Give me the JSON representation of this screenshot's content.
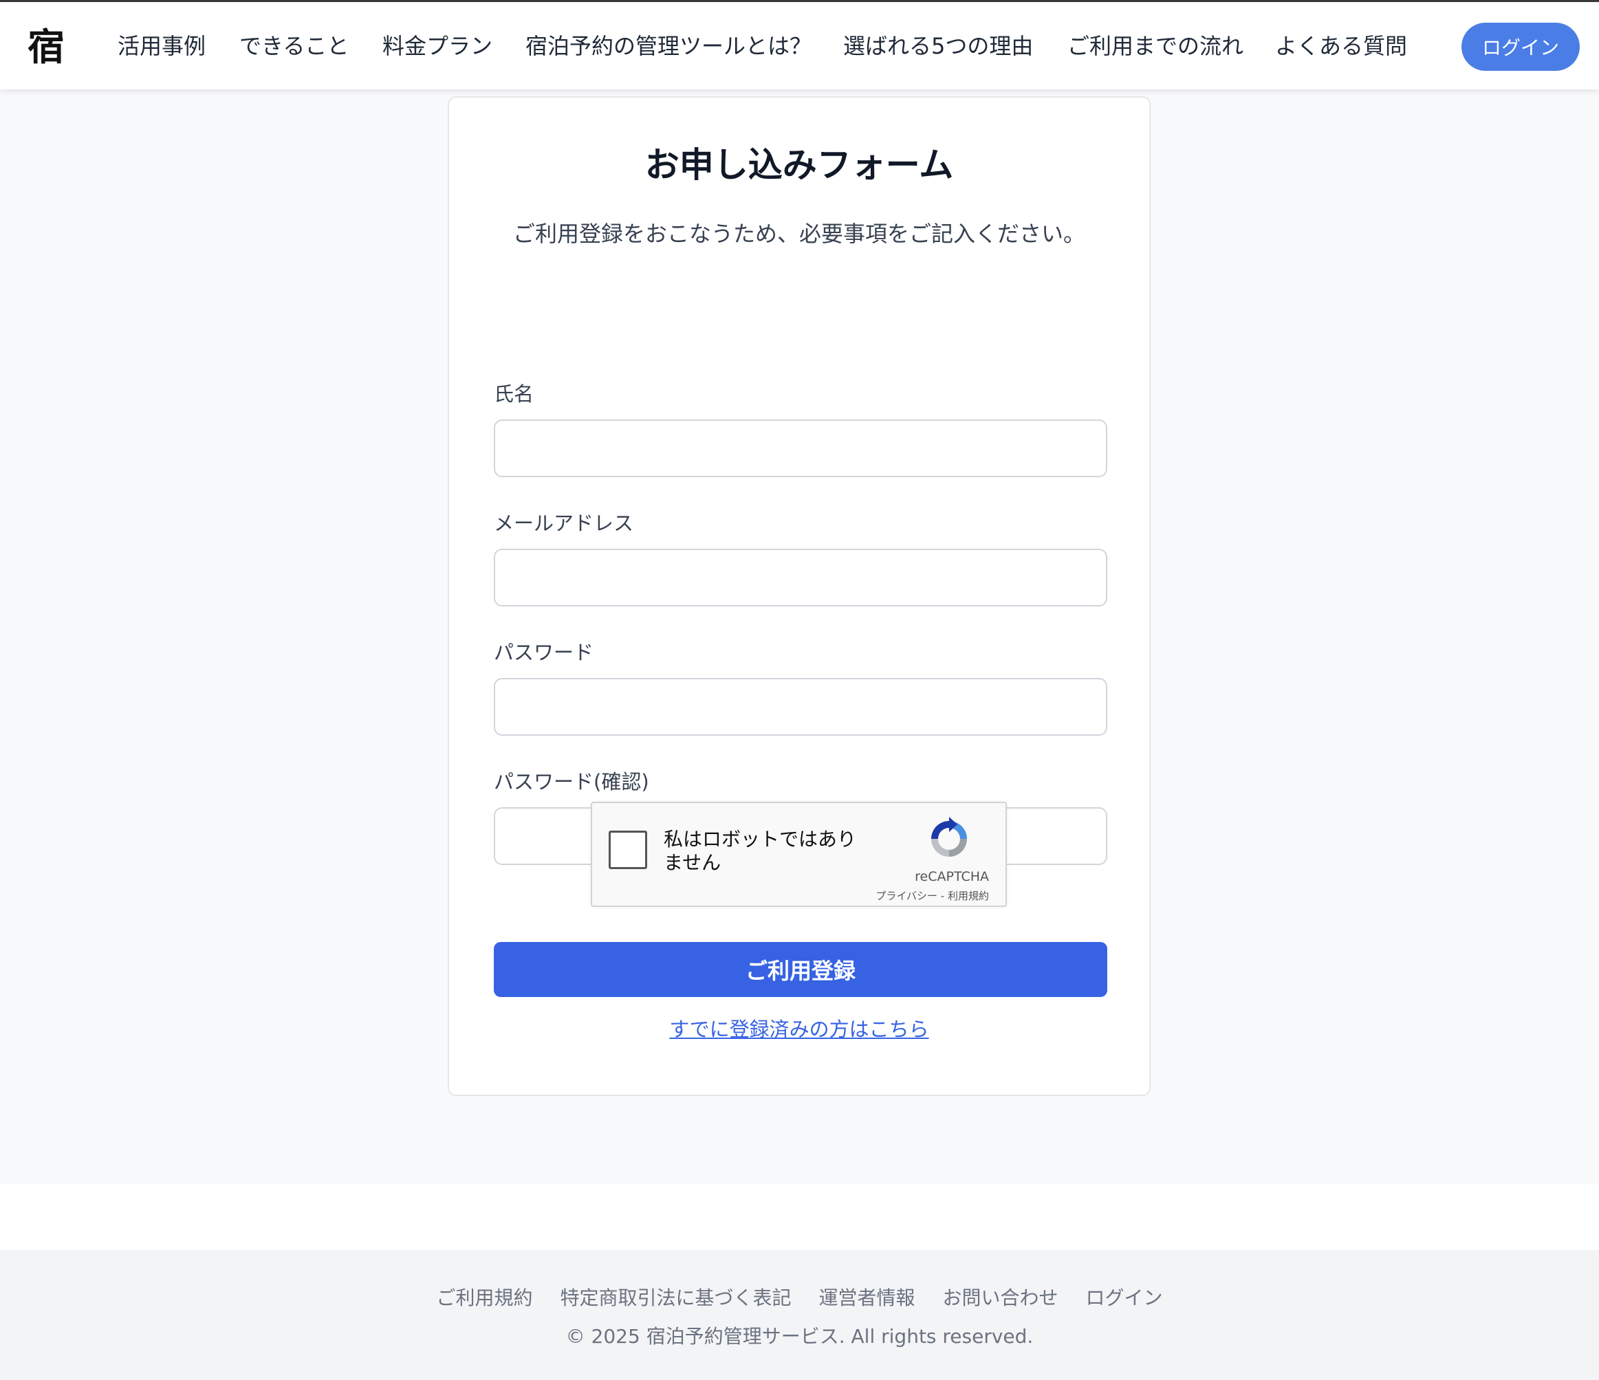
{
  "header": {
    "logo_glyph": "宿",
    "nav": [
      {
        "label": "活用事例"
      },
      {
        "label": "できること"
      },
      {
        "label": "料金プラン"
      },
      {
        "label": "宿泊予約の管理ツールとは？"
      },
      {
        "label": "選ばれる5つの理由"
      },
      {
        "label": "ご利用までの流れ"
      },
      {
        "label": "よくある質問"
      }
    ],
    "login_label": "ログイン",
    "accent_color": "#4a7ee6"
  },
  "form": {
    "title": "お申し込みフォーム",
    "subtitle": "ご利用登録をおこなうため、必要事項をご記入ください。",
    "fields": [
      {
        "label": "氏名",
        "value": "",
        "placeholder": ""
      },
      {
        "label": "メールアドレス",
        "value": "",
        "placeholder": ""
      },
      {
        "label": "パスワード",
        "value": "",
        "placeholder": ""
      },
      {
        "label": "パスワード(確認)",
        "value": "",
        "placeholder": ""
      }
    ],
    "captcha": {
      "label": "私はロボットではありません",
      "brand": "reCAPTCHA",
      "links": "プライバシー - 利用規約",
      "checked": false
    },
    "submit_label": "ご利用登録",
    "submit_color": "#3662e3",
    "signin_link": "すでに登録済みの方はこちら"
  },
  "footer": {
    "links": [
      {
        "label": "ご利用規約"
      },
      {
        "label": "特定商取引法に基づく表記"
      },
      {
        "label": "運営者情報"
      },
      {
        "label": "お問い合わせ"
      },
      {
        "label": "ログイン"
      }
    ],
    "copyright": "© 2025 宿泊予約管理サービス. All rights reserved."
  }
}
